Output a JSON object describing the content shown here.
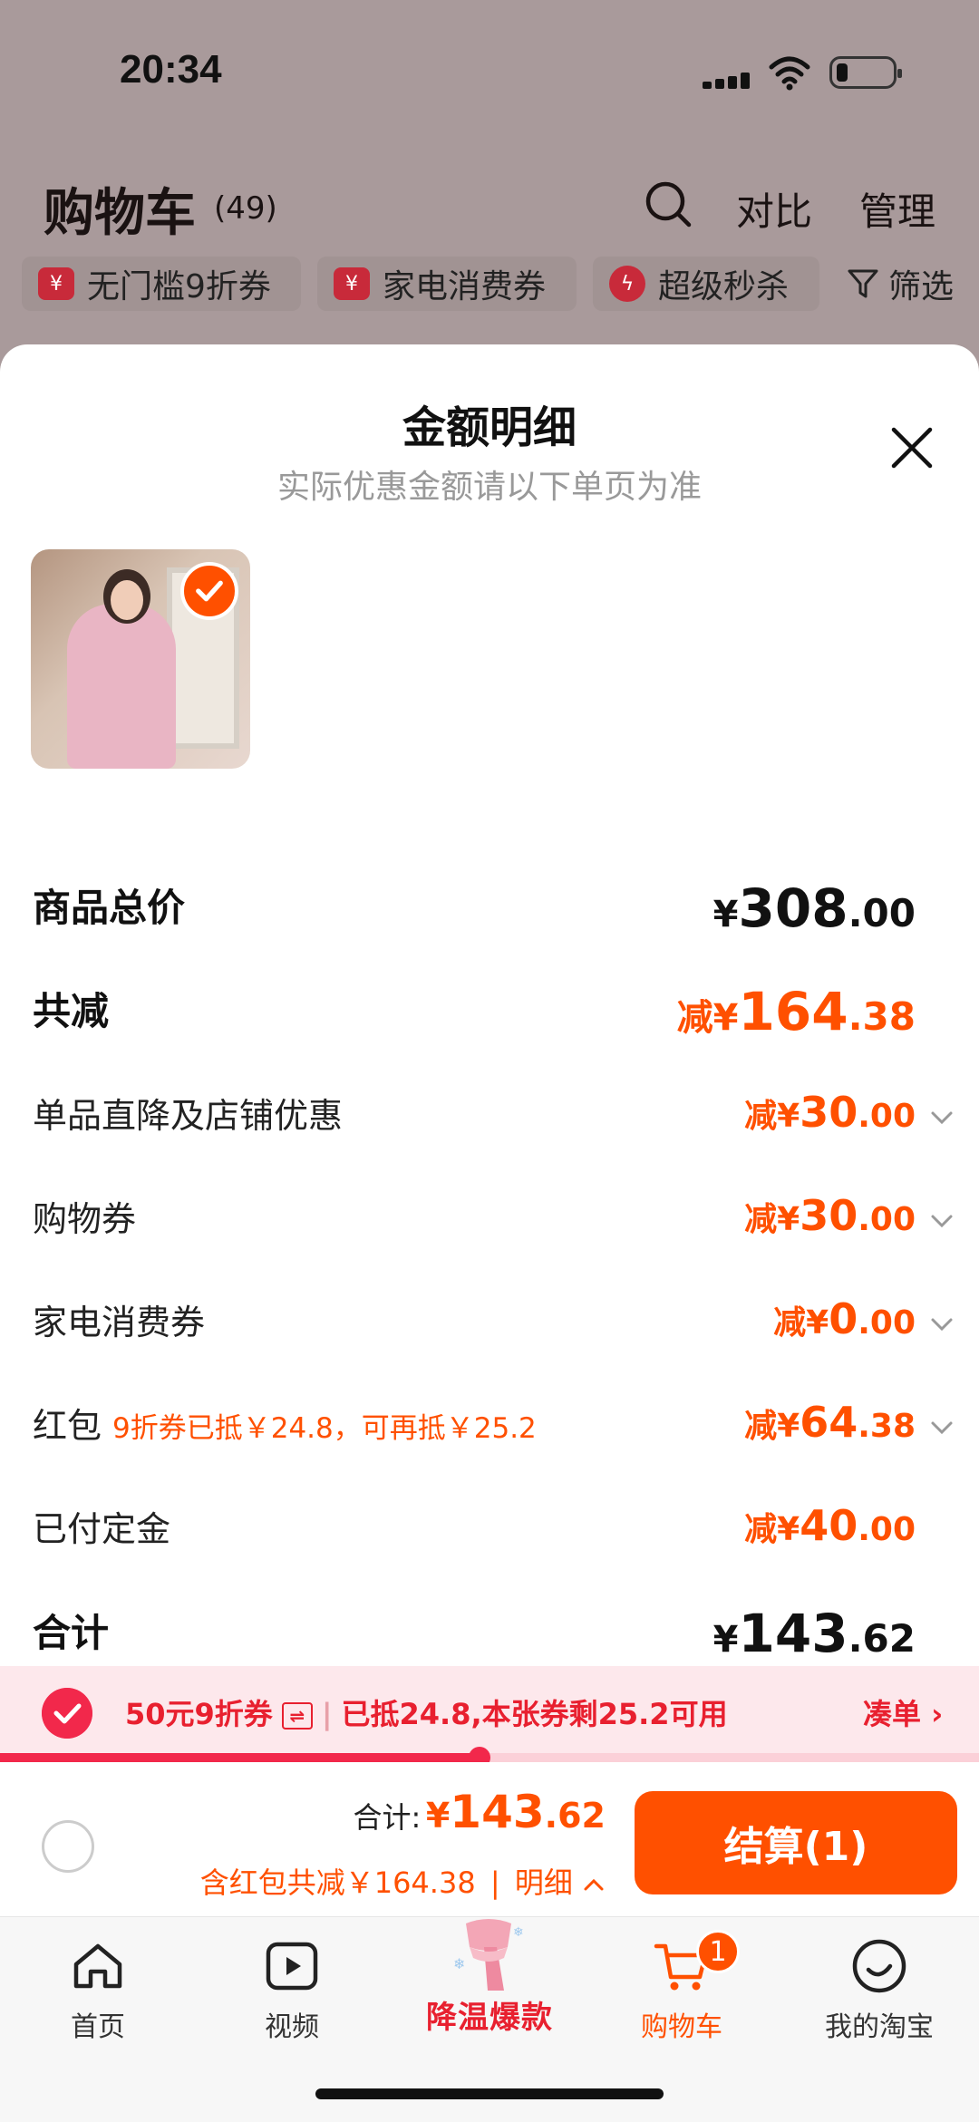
{
  "status_bar": {
    "time": "20:34"
  },
  "cart_header": {
    "title": "购物车",
    "count": "(49)",
    "compare": "对比",
    "manage": "管理"
  },
  "chips": [
    {
      "icon": "yen-coupon-icon",
      "label": "无门槛9折券"
    },
    {
      "icon": "yen-coupon-icon",
      "label": "家电消费券"
    },
    {
      "icon": "lightning-icon",
      "label": "超级秒杀"
    }
  ],
  "filter": {
    "label": "筛选"
  },
  "sheet": {
    "title": "金额明细",
    "subtitle": "实际优惠金额请以下单页为准"
  },
  "rows": {
    "total_price": {
      "label": "商品总价",
      "prefix": "",
      "cur": "¥",
      "int": "308",
      "dec": ".00"
    },
    "total_discount": {
      "label": "共减",
      "prefix": "减",
      "cur": "¥",
      "int": "164",
      "dec": ".38"
    },
    "store_discount": {
      "label": "单品直降及店铺优惠",
      "prefix": "减",
      "cur": "¥",
      "int": "30",
      "dec": ".00"
    },
    "shopping_coupon": {
      "label": "购物券",
      "prefix": "减",
      "cur": "¥",
      "int": "30",
      "dec": ".00"
    },
    "appliance_coupon": {
      "label": "家电消费券",
      "prefix": "减",
      "cur": "¥",
      "int": "0",
      "dec": ".00"
    },
    "red_packet": {
      "label": "红包",
      "note": "9折券已抵￥24.8，可再抵￥25.2",
      "prefix": "减",
      "cur": "¥",
      "int": "64",
      "dec": ".38"
    },
    "deposit_paid": {
      "label": "已付定金",
      "prefix": "减",
      "cur": "¥",
      "int": "40",
      "dec": ".00"
    },
    "subtotal": {
      "label": "合计",
      "prefix": "",
      "cur": "¥",
      "int": "143",
      "dec": ".62"
    }
  },
  "promo_bar": {
    "coupon": "50元9折券",
    "swap_icon": "⇌",
    "detail": "已抵24.8,本张券剩25.2可用",
    "link": "凑单",
    "progress": 0.49
  },
  "checkout": {
    "total_label": "合计:",
    "cur": "¥",
    "int": "143",
    "dec": ".62",
    "discount_note": "含红包共减￥164.38",
    "detail_link": "明细",
    "button": "结算(1)"
  },
  "tabs": [
    {
      "icon": "home-icon",
      "label": "首页"
    },
    {
      "icon": "video-icon",
      "label": "视频"
    },
    {
      "icon": "scarf-promo-icon",
      "label": "降温爆款"
    },
    {
      "icon": "cart-icon",
      "label": "购物车",
      "badge": "1"
    },
    {
      "icon": "smile-icon",
      "label": "我的淘宝"
    }
  ],
  "colors": {
    "accent": "#ff5000",
    "promo_red": "#f2284b"
  }
}
